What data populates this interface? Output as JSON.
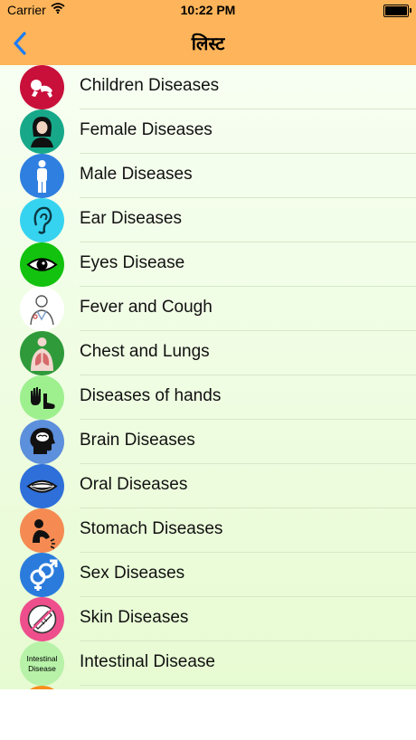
{
  "status": {
    "carrier": "Carrier",
    "time": "10:22 PM"
  },
  "nav": {
    "title": "लिस्ट",
    "back_icon": "chevron-left-icon"
  },
  "colors": {
    "header": "#fdb45a",
    "back": "#1a7cf5"
  },
  "items": [
    {
      "label": "Children Diseases",
      "icon": "baby-icon",
      "color": "#c8103a"
    },
    {
      "label": "Female Diseases",
      "icon": "woman-icon",
      "color": "#17a88a"
    },
    {
      "label": "Male Diseases",
      "icon": "man-icon",
      "color": "#2f7fe0"
    },
    {
      "label": "Ear Diseases",
      "icon": "ear-icon",
      "color": "#36d3f0"
    },
    {
      "label": "Eyes Disease",
      "icon": "eye-icon",
      "color": "#12c20e"
    },
    {
      "label": "Fever and Cough",
      "icon": "doctor-icon",
      "color": "#ffffff"
    },
    {
      "label": "Chest and Lungs",
      "icon": "lungs-icon",
      "color": "#2f9a3a"
    },
    {
      "label": "Diseases of hands",
      "icon": "hand-foot-icon",
      "color": "#9ef08f"
    },
    {
      "label": "Brain Diseases",
      "icon": "brain-icon",
      "color": "#5c8fdc"
    },
    {
      "label": "Oral Diseases",
      "icon": "mouth-icon",
      "color": "#2e6fd9"
    },
    {
      "label": "Stomach Diseases",
      "icon": "stomach-icon",
      "color": "#f58b52"
    },
    {
      "label": "Sex Diseases",
      "icon": "gender-icon",
      "color": "#2a7bdc"
    },
    {
      "label": "Skin Diseases",
      "icon": "skin-icon",
      "color": "#ee4f8c"
    },
    {
      "label": "Intestinal Disease",
      "icon": "intestinal-icon",
      "color": "#b7f2a8",
      "icon_text_1": "Intestinal",
      "icon_text_2": "Disease"
    }
  ]
}
